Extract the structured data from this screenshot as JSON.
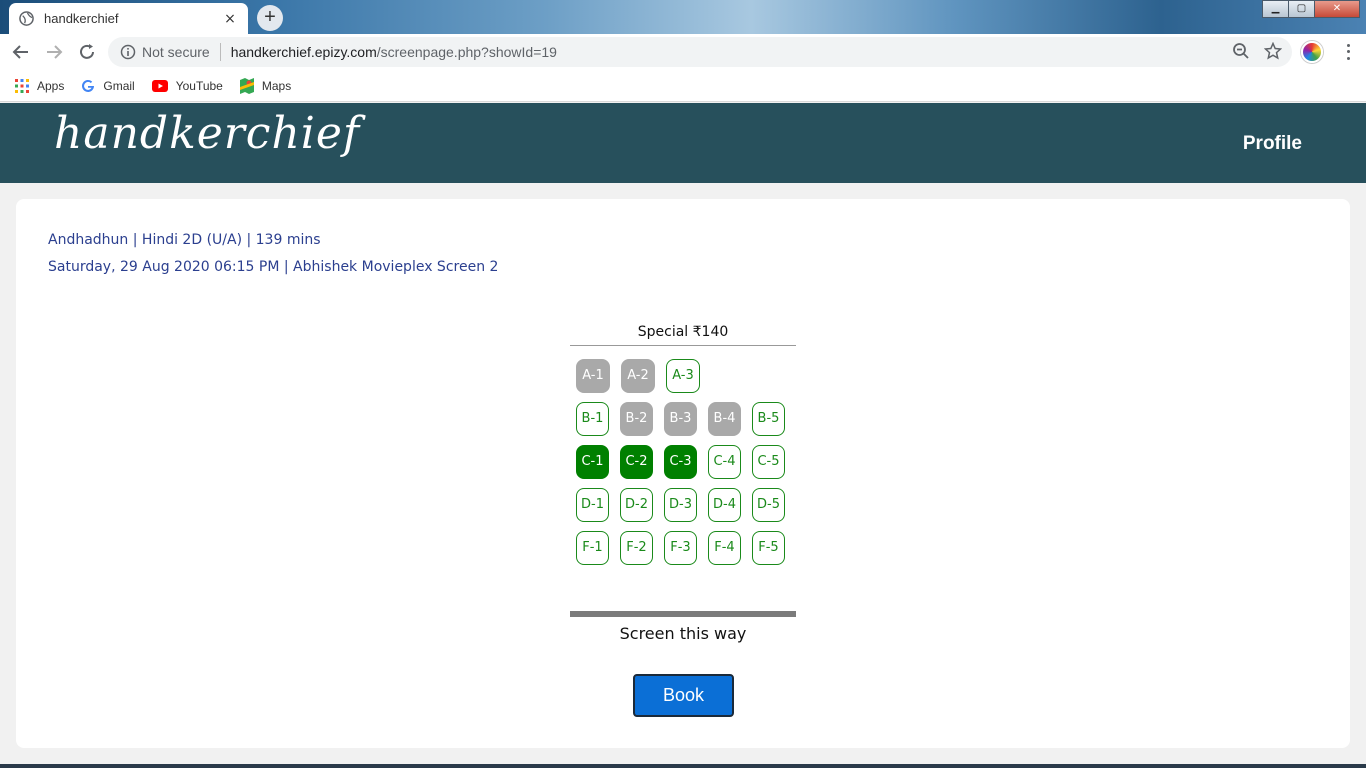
{
  "browser": {
    "tab_title": "handkerchief",
    "tab_close": "×",
    "new_tab": "+",
    "security_label": "Not secure",
    "url_host": "handkerchief.epizy.com",
    "url_path": "/screenpage.php?showId=19",
    "window_buttons": {
      "minimize": "▁",
      "maximize": "▢",
      "close": "✕"
    },
    "bookmarks": [
      {
        "label": "Apps",
        "icon": "apps-grid-icon"
      },
      {
        "label": "Gmail",
        "icon": "google-icon"
      },
      {
        "label": "YouTube",
        "icon": "youtube-icon"
      },
      {
        "label": "Maps",
        "icon": "maps-icon"
      }
    ]
  },
  "site": {
    "logo": "handkerchief",
    "nav_profile": "Profile",
    "header_color": "#27505c"
  },
  "show": {
    "line1": "Andhadhun | Hindi 2D  (U/A) | 139 mins",
    "line2": "Saturday, 29 Aug 2020 06:15 PM | Abhishek Movieplex Screen 2"
  },
  "seating": {
    "tier": "Special  ₹140",
    "rows": [
      [
        {
          "label": "A-1",
          "status": "sold"
        },
        {
          "label": "A-2",
          "status": "sold"
        },
        {
          "label": "A-3",
          "status": "available"
        }
      ],
      [
        {
          "label": "B-1",
          "status": "available"
        },
        {
          "label": "B-2",
          "status": "sold"
        },
        {
          "label": "B-3",
          "status": "sold"
        },
        {
          "label": "B-4",
          "status": "sold"
        },
        {
          "label": "B-5",
          "status": "available"
        }
      ],
      [
        {
          "label": "C-1",
          "status": "selected"
        },
        {
          "label": "C-2",
          "status": "selected"
        },
        {
          "label": "C-3",
          "status": "selected"
        },
        {
          "label": "C-4",
          "status": "available"
        },
        {
          "label": "C-5",
          "status": "available"
        }
      ],
      [
        {
          "label": "D-1",
          "status": "available"
        },
        {
          "label": "D-2",
          "status": "available"
        },
        {
          "label": "D-3",
          "status": "available"
        },
        {
          "label": "D-4",
          "status": "available"
        },
        {
          "label": "D-5",
          "status": "available"
        }
      ],
      [
        {
          "label": "F-1",
          "status": "available"
        },
        {
          "label": "F-2",
          "status": "available"
        },
        {
          "label": "F-3",
          "status": "available"
        },
        {
          "label": "F-4",
          "status": "available"
        },
        {
          "label": "F-5",
          "status": "available"
        }
      ]
    ],
    "colors": {
      "available": "#1a8a1a",
      "sold": "#a9a9a9",
      "selected": "#008000"
    },
    "screen_label": "Screen this way"
  },
  "actions": {
    "book_label": "Book",
    "book_color": "#0b6fd6"
  }
}
